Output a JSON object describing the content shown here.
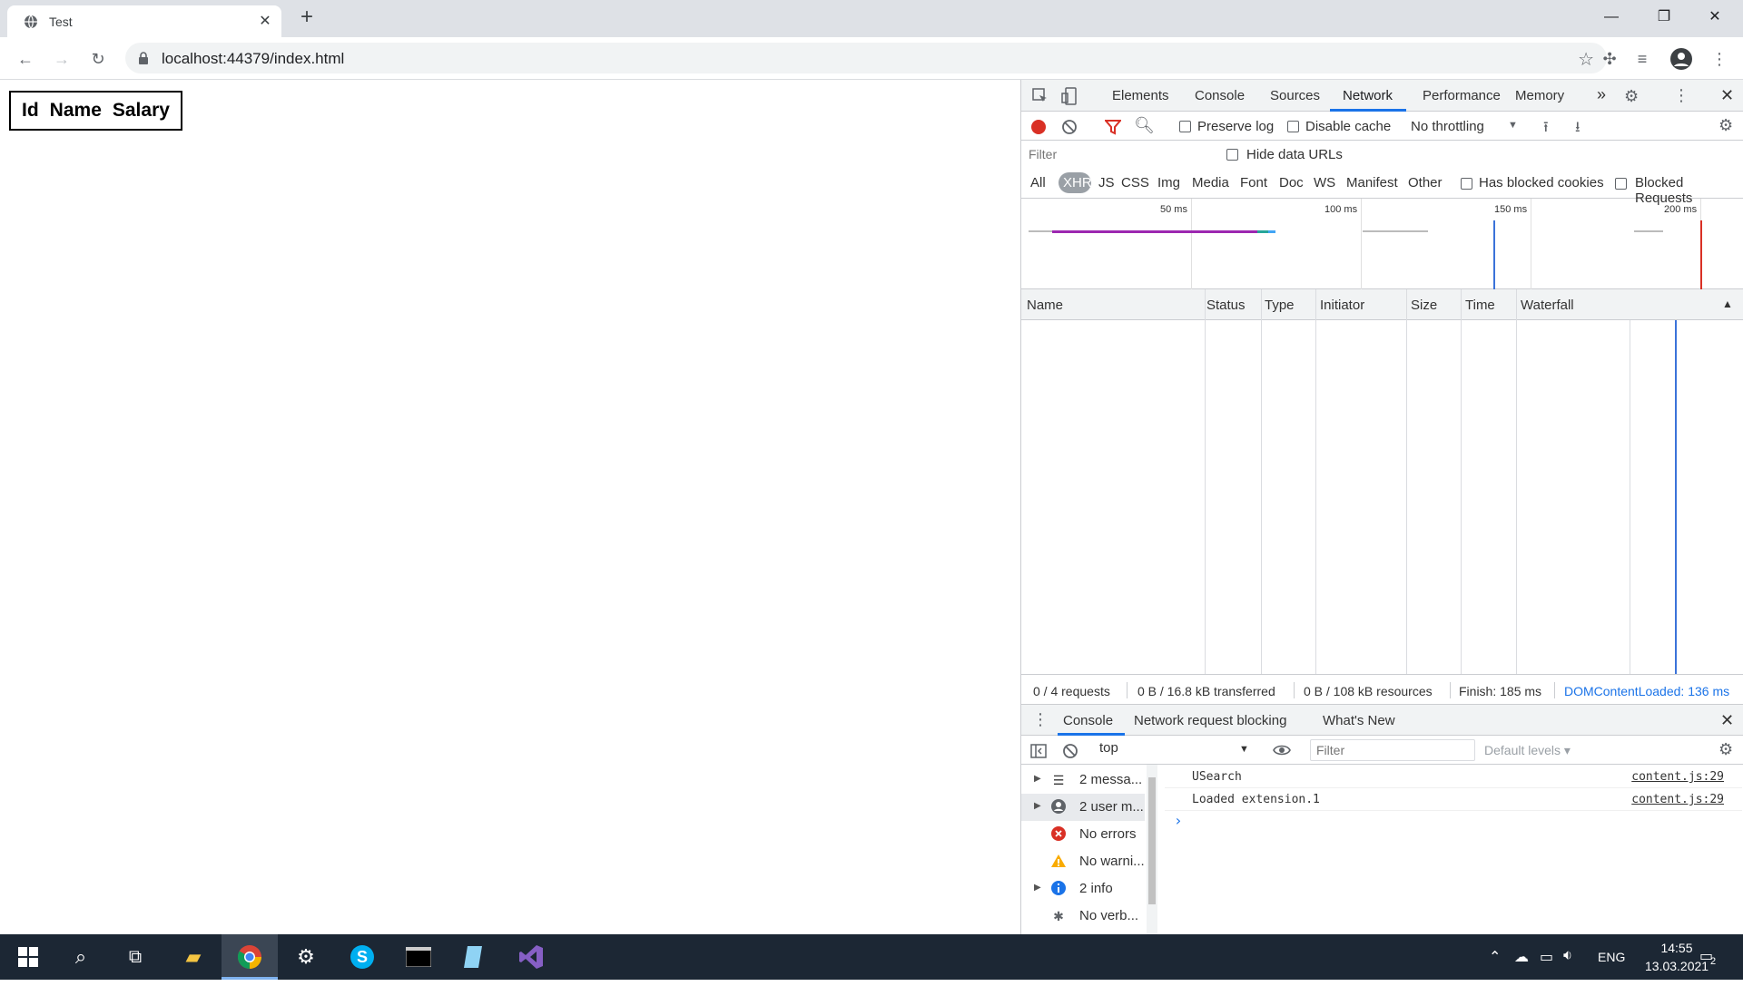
{
  "browser": {
    "tab_title": "Test",
    "url": "localhost:44379/index.html"
  },
  "page": {
    "table_headers": [
      "Id",
      "Name",
      "Salary"
    ]
  },
  "devtools": {
    "tabs": [
      "Elements",
      "Console",
      "Sources",
      "Network",
      "Performance",
      "Memory"
    ],
    "active_tab": "Network",
    "more_tabs": "»",
    "network_toolbar": {
      "preserve_log": "Preserve log",
      "disable_cache": "Disable cache",
      "throttling": "No throttling"
    },
    "filter_placeholder": "Filter",
    "hide_data_urls": "Hide data URLs",
    "type_filters": [
      "All",
      "XHR",
      "JS",
      "CSS",
      "Img",
      "Media",
      "Font",
      "Doc",
      "WS",
      "Manifest",
      "Other"
    ],
    "active_type": "XHR",
    "has_blocked_cookies": "Has blocked cookies",
    "blocked_requests": "Blocked Requests",
    "overview_ticks": [
      "50 ms",
      "100 ms",
      "150 ms",
      "200 ms"
    ],
    "columns": [
      "Name",
      "Status",
      "Type",
      "Initiator",
      "Size",
      "Time",
      "Waterfall"
    ],
    "summary": {
      "requests": "0 / 4 requests",
      "transferred": "0 B / 16.8 kB transferred",
      "resources": "0 B / 108 kB resources",
      "finish": "Finish: 185 ms",
      "dom_content_loaded": "DOMContentLoaded: 136 ms"
    },
    "drawer_tabs": [
      "Console",
      "Network request blocking",
      "What's New"
    ],
    "console": {
      "context": "top",
      "filter_placeholder": "Filter",
      "default_levels": "Default levels ▾",
      "sidebar": [
        {
          "label": "2 messa...",
          "icon": "list-icon"
        },
        {
          "label": "2 user m...",
          "icon": "user-icon"
        },
        {
          "label": "No errors",
          "icon": "error-icon"
        },
        {
          "label": "No warni...",
          "icon": "warning-icon"
        },
        {
          "label": "2 info",
          "icon": "info-icon"
        },
        {
          "label": "No verb...",
          "icon": "bug-icon"
        }
      ],
      "messages": [
        {
          "text": "USearch",
          "source": "content.js:29"
        },
        {
          "text": "Loaded extension.1",
          "source": "content.js:29"
        }
      ],
      "prompt": "›"
    }
  },
  "taskbar": {
    "language": "ENG",
    "time": "14:55",
    "date": "13.03.2021",
    "notifications": "2"
  },
  "colors": {
    "accent": "#1a73e8",
    "record": "#d93025",
    "filter_active": "#d93025"
  }
}
